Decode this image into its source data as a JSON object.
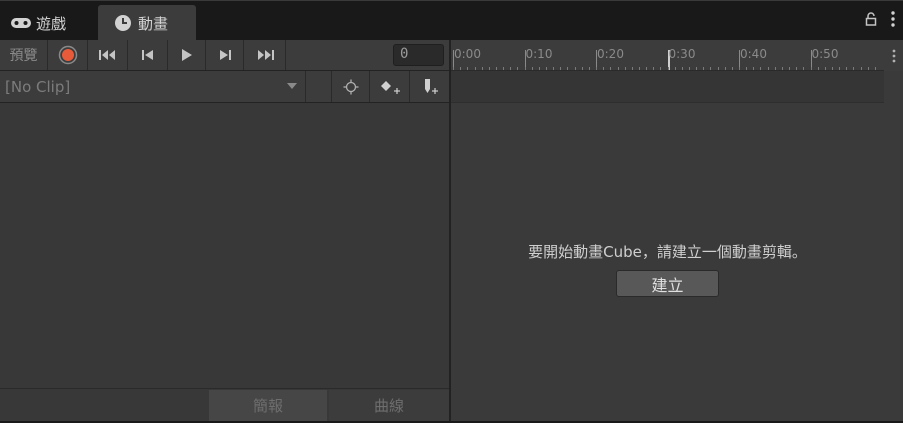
{
  "tabs": [
    {
      "label": "遊戲",
      "icon": "gamepad-icon"
    },
    {
      "label": "動畫",
      "icon": "clock-icon"
    }
  ],
  "window_controls": {
    "lock_icon": "lock-icon",
    "menu_icon": "kebab-menu-icon"
  },
  "toolbar": {
    "preview_label": "預覽",
    "record_color": "#e85b3a",
    "frame_value": "0"
  },
  "clip": {
    "selected": "[No Clip]"
  },
  "timeline": {
    "labels": [
      "0:00",
      "0:10",
      "0:20",
      "0:30",
      "0:40",
      "0:50"
    ]
  },
  "empty_state": {
    "message": "要開始動畫Cube，請建立一個動畫剪輯。",
    "create_label": "建立"
  },
  "bottom_tabs": {
    "summary": "簡報",
    "curves": "曲線"
  }
}
